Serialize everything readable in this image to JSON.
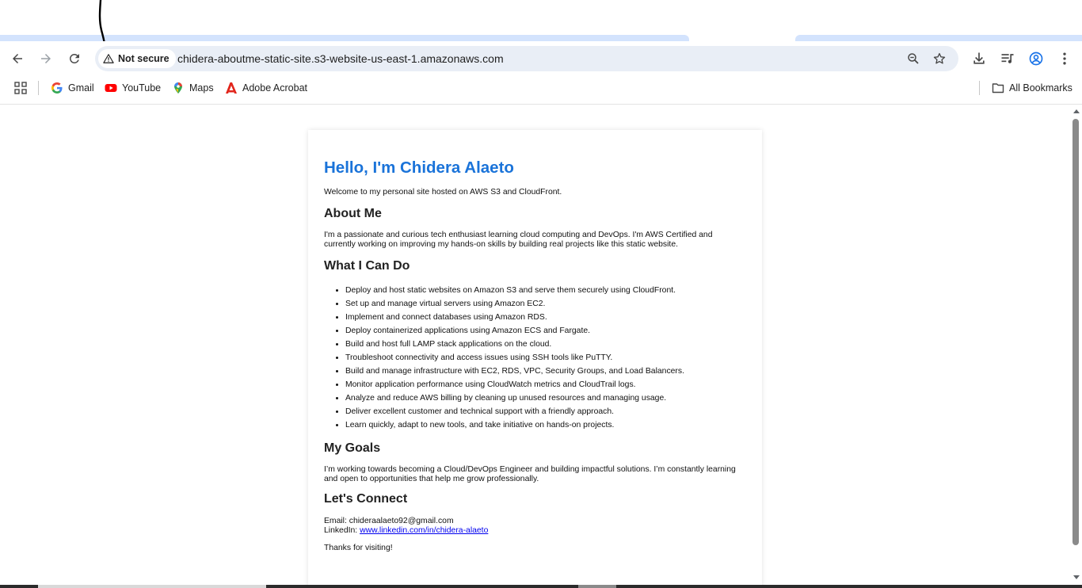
{
  "toolbar": {
    "security_label": "Not secure",
    "url": "chidera-aboutme-static-site.s3-website-us-east-1.amazonaws.com"
  },
  "icons": {
    "back": "arrow-left",
    "forward": "arrow-right",
    "reload": "reload",
    "warning": "warning-triangle",
    "zoom": "zoom-magnifier",
    "bookmark_star": "star-outline",
    "downloads": "download",
    "media": "media-playlist",
    "profile": "account-circle",
    "menu": "kebab-menu"
  },
  "bookmarks": {
    "items": [
      {
        "label": "Gmail"
      },
      {
        "label": "YouTube"
      },
      {
        "label": "Maps"
      },
      {
        "label": "Adobe Acrobat"
      }
    ],
    "all_bookmarks": "All Bookmarks"
  },
  "page": {
    "heading": "Hello, I'm Chidera Alaeto",
    "intro": "Welcome to my personal site hosted on AWS S3 and CloudFront.",
    "about_title": "About Me",
    "about_text": "I'm a passionate and curious tech enthusiast learning cloud computing and DevOps. I'm AWS Certified and currently working on improving my hands-on skills by building real projects like this static website.",
    "skills_title": "What I Can Do",
    "skills": [
      "Deploy and host static websites on Amazon S3 and serve them securely using CloudFront.",
      "Set up and manage virtual servers using Amazon EC2.",
      "Implement and connect databases using Amazon RDS.",
      "Deploy containerized applications using Amazon ECS and Fargate.",
      "Build and host full LAMP stack applications on the cloud.",
      "Troubleshoot connectivity and access issues using SSH tools like PuTTY.",
      "Build and manage infrastructure with EC2, RDS, VPC, Security Groups, and Load Balancers.",
      "Monitor application performance using CloudWatch metrics and CloudTrail logs.",
      "Analyze and reduce AWS billing by cleaning up unused resources and managing usage.",
      "Deliver excellent customer and technical support with a friendly approach.",
      "Learn quickly, adapt to new tools, and take initiative on hands-on projects."
    ],
    "goals_title": "My Goals",
    "goals_text": "I’m working towards becoming a Cloud/DevOps Engineer and building impactful solutions. I’m constantly learning and open to opportunities that help me grow professionally.",
    "connect_title": "Let's Connect",
    "email_label": "Email:",
    "email": "chideraalaeto92@gmail.com",
    "linkedin_label": "LinkedIn:",
    "linkedin": "www.linkedin.com/in/chidera-alaeto",
    "thanks": "Thanks for visiting!"
  },
  "colors": {
    "heading_blue": "#1a73d9",
    "link": "#0000ee",
    "omnibox": "#e9eef6",
    "tab_band": "#d3e3fd"
  }
}
